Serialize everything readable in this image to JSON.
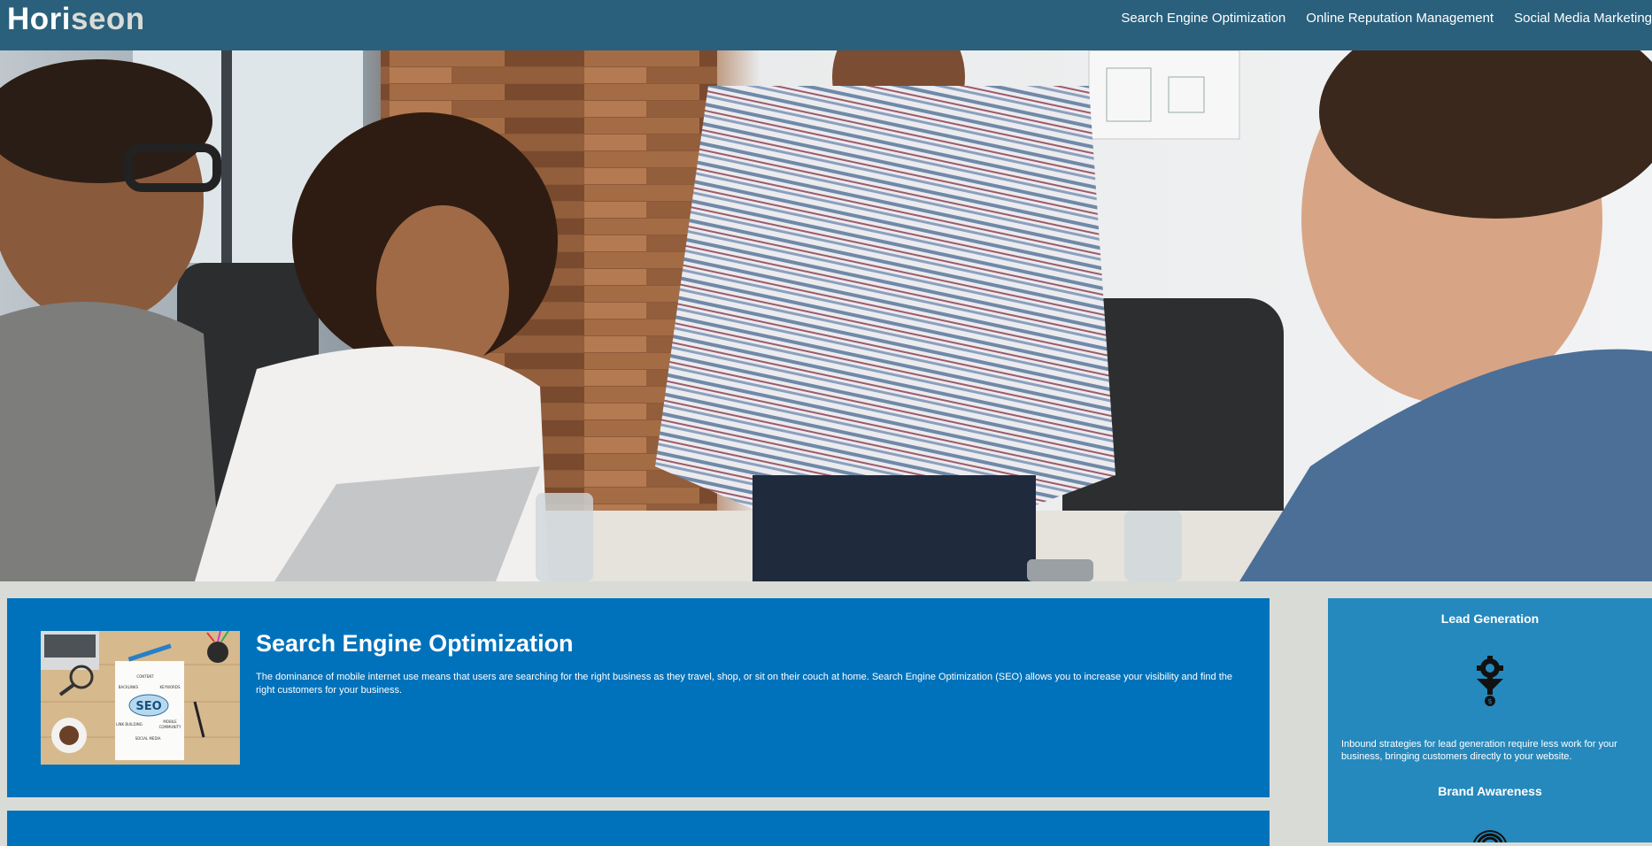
{
  "header": {
    "logo_main": "Hori",
    "logo_accent": "seon",
    "nav": [
      {
        "label": "Search Engine Optimization"
      },
      {
        "label": "Online Reputation Management"
      },
      {
        "label": "Social Media Marketing"
      }
    ]
  },
  "hero": {
    "image_icon": "team-meeting-photo"
  },
  "content": {
    "seo": {
      "title": "Search Engine Optimization",
      "text": "The dominance of mobile internet use means that users are searching for the right business as they travel, shop, or sit on their couch at home. Search Engine Optimization (SEO) allows you to increase your visibility and find the right customers for your business.",
      "image_icon": "seo-notebook-photo",
      "image_words": [
        "SEO",
        "CONTENT",
        "BACKLINKS",
        "KEYWORDS",
        "LINK BUILDING",
        "MOBILE",
        "SOCIAL MEDIA",
        "COMMUNITY"
      ]
    }
  },
  "aside": {
    "lead": {
      "title": "Lead Generation",
      "text": "Inbound strategies for lead generation require less work for your business, bringing customers directly to your website.",
      "icon": "funnel-gear-dollar-icon"
    },
    "brand": {
      "title": "Brand Awareness",
      "icon": "broadcast-icon"
    }
  },
  "colors": {
    "header_bg": "#2a607c",
    "page_bg": "#d9dcd6",
    "card_bg": "#0072bb",
    "aside_bg": "#2589bd"
  }
}
